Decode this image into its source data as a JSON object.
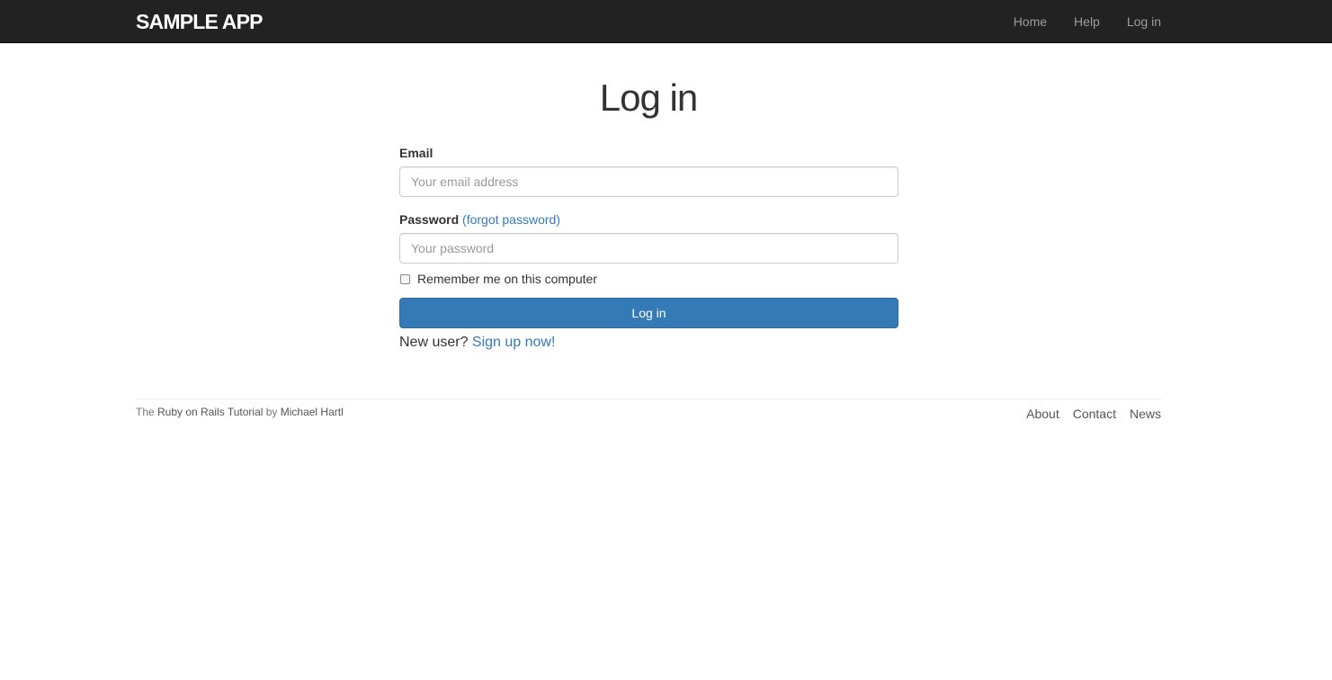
{
  "header": {
    "brand": "SAMPLE APP",
    "nav": [
      {
        "label": "Home"
      },
      {
        "label": "Help"
      },
      {
        "label": "Log in"
      }
    ]
  },
  "main": {
    "title": "Log in",
    "email": {
      "label": "Email",
      "placeholder": "Your email address",
      "value": ""
    },
    "password": {
      "label": "Password",
      "forgot_link": "(forgot password)",
      "placeholder": "Your password",
      "value": ""
    },
    "remember": {
      "label": "Remember me on this computer",
      "checked": false
    },
    "submit_label": "Log in",
    "signup": {
      "prefix": "New user? ",
      "link": "Sign up now!"
    }
  },
  "footer": {
    "credit_prefix": "The ",
    "credit_link1": "Ruby on Rails Tutorial",
    "credit_mid": " by ",
    "credit_link2": "Michael Hartl",
    "links": [
      {
        "label": "About"
      },
      {
        "label": "Contact"
      },
      {
        "label": "News"
      }
    ]
  },
  "colors": {
    "navbar_bg": "#222222",
    "primary": "#337ab7",
    "link": "#337ab7"
  }
}
